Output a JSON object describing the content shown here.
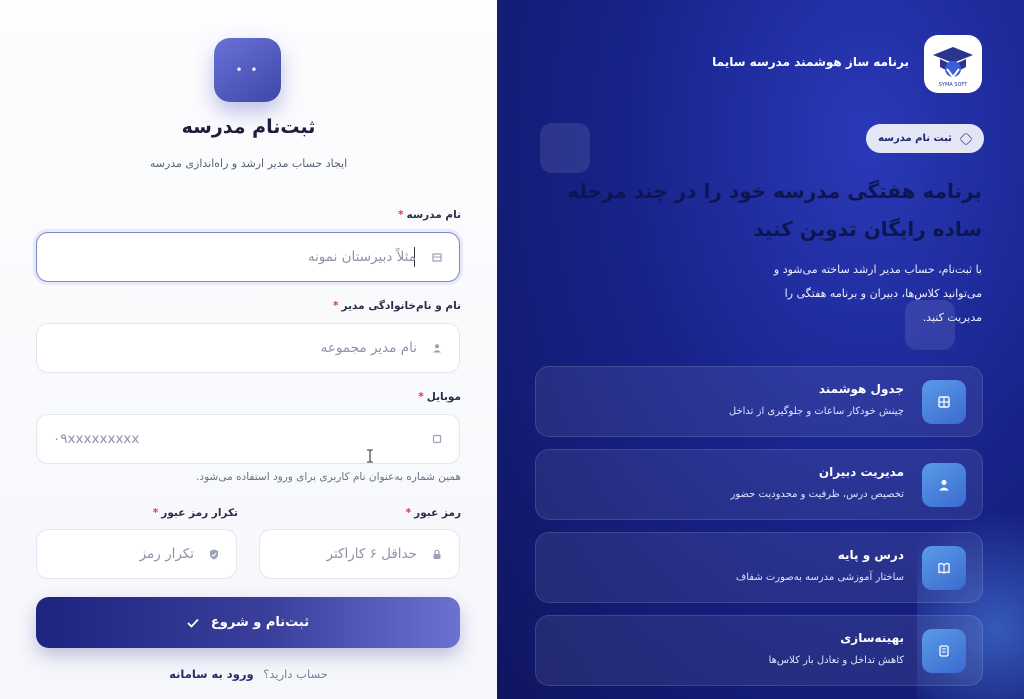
{
  "form": {
    "title": "ثبت‌نام مدرسه",
    "subtitle": "ایجاد حساب مدیر ارشد و راه‌اندازی مدرسه",
    "school_name": {
      "label": "نام مدرسه",
      "placeholder": "مثلاً دبیرستان نمونه"
    },
    "manager_name": {
      "label": "نام و نام‌خانوادگی مدیر",
      "placeholder": "نام مدیر مجموعه"
    },
    "mobile": {
      "label": "موبایل",
      "placeholder": "۰۹xxxxxxxxx",
      "hint": "همین شماره به‌عنوان نام کاربری برای ورود استفاده می‌شود."
    },
    "password": {
      "label": "رمز عبور",
      "placeholder": "حداقل ۶ کاراکتر"
    },
    "password_repeat": {
      "label": "تکرار رمز عبور",
      "placeholder": "تکرار رمز"
    },
    "required_mark": "*",
    "submit_label": "ثبت‌نام و شروع",
    "have_account": "حساب دارید؟",
    "login_link": "ورود به سامانه"
  },
  "promo": {
    "brand_name": "برنامه ساز هوشمند مدرسه سایما",
    "logo_text": "SYMA SOFT",
    "pill_label": "ثبت نام مدرسه",
    "headline": "برنامه هفتگی مدرسه خود را در چند مرحله ساده رایگان تدوین کنید",
    "intro": "با ثبت‌نام، حساب مدیر ارشد ساخته می‌شود و می‌توانید کلاس‌ها، دبیران و برنامه هفتگی را مدیریت کنید.",
    "features": [
      {
        "title": "جدول هوشمند",
        "desc": "چینش خودکار ساعات و جلوگیری از تداخل",
        "icon": "grid-icon"
      },
      {
        "title": "مدیریت دبیران",
        "desc": "تخصیص درس، ظرفیت و محدودیت حضور",
        "icon": "teacher-icon"
      },
      {
        "title": "درس و پایه",
        "desc": "ساختار آموزشی مدرسه به‌صورت شفاف",
        "icon": "book-icon"
      },
      {
        "title": "بهینه‌سازی",
        "desc": "کاهش تداخل و تعادل بار کلاس‌ها",
        "icon": "optimize-icon"
      }
    ]
  },
  "colors": {
    "primary": "#2a2f8f",
    "promo_bg": "#18238a",
    "required": "#e0344f",
    "feature_icon": "#4a84dc"
  }
}
